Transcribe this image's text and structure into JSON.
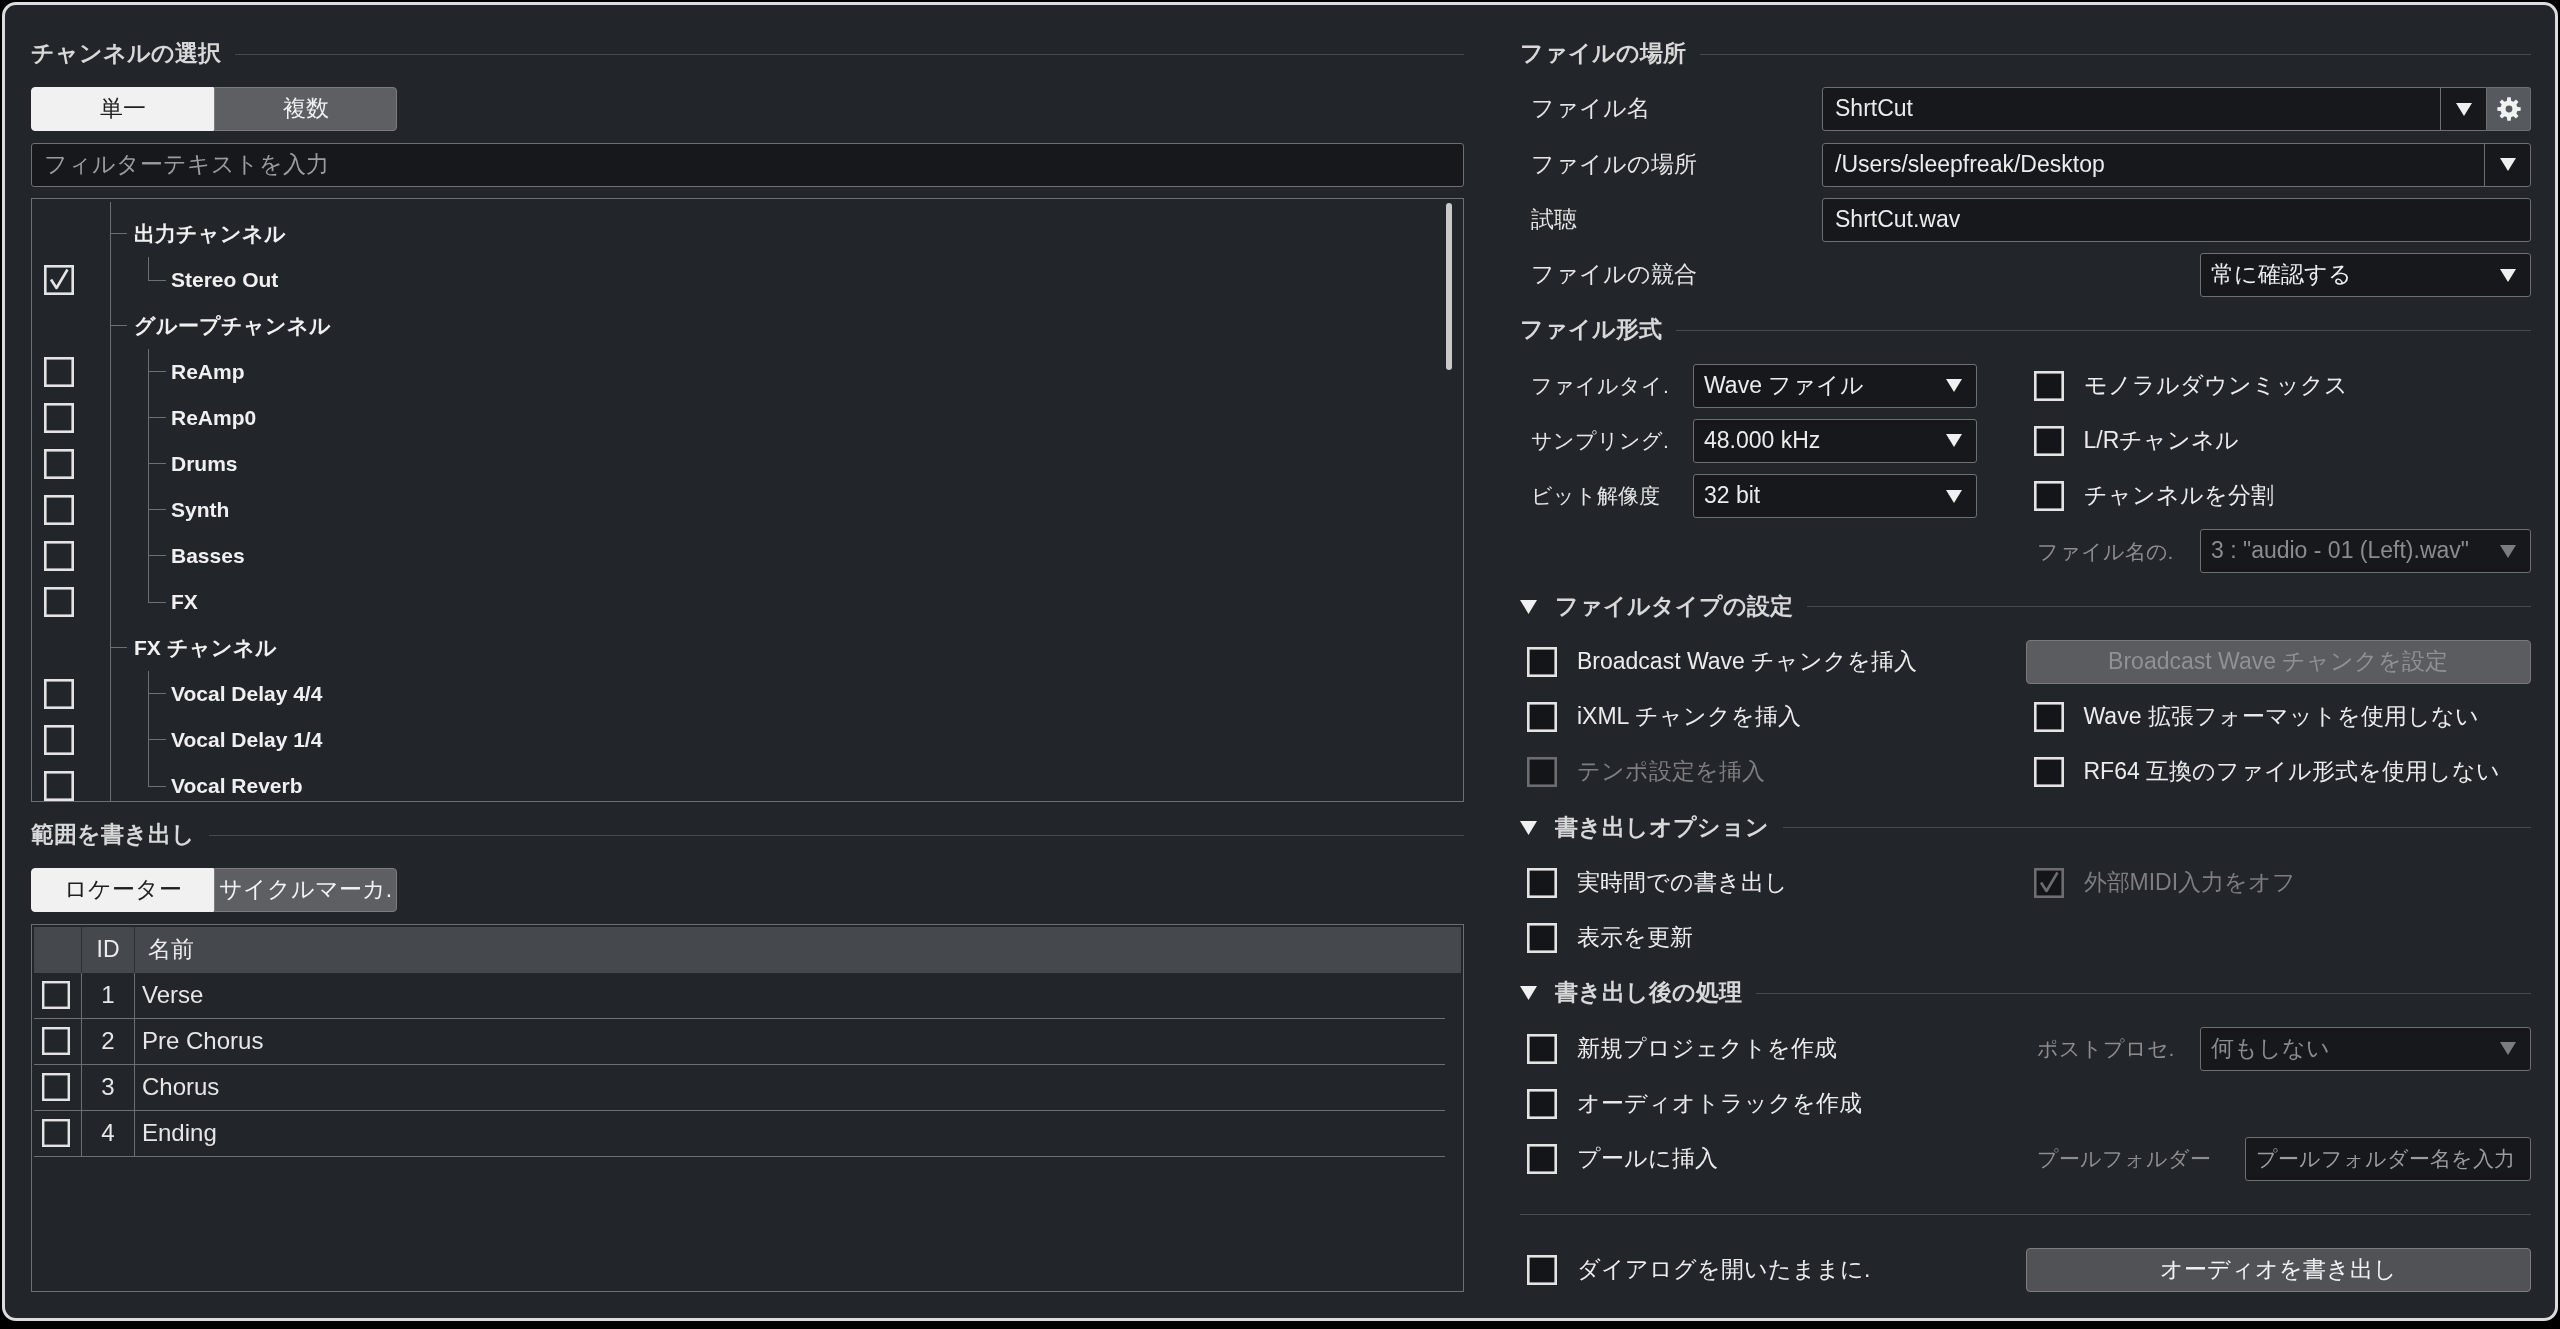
{
  "channel_selection": {
    "title": "チャンネルの選択",
    "modes": [
      {
        "label": "単一",
        "selected": true
      },
      {
        "label": "複数",
        "selected": false
      }
    ],
    "filter": {
      "placeholder": "フィルターテキストを入力"
    },
    "tree": [
      {
        "label": "出力チャンネル",
        "children": [
          {
            "label": "Stereo Out",
            "checked": true
          }
        ]
      },
      {
        "label": "グループチャンネル",
        "children": [
          {
            "label": "ReAmp",
            "checked": false
          },
          {
            "label": "ReAmp0",
            "checked": false
          },
          {
            "label": "Drums",
            "checked": false
          },
          {
            "label": "Synth",
            "checked": false
          },
          {
            "label": "Basses",
            "checked": false
          },
          {
            "label": "FX",
            "checked": false
          }
        ]
      },
      {
        "label": "FX チャンネル",
        "children": [
          {
            "label": "Vocal Delay 4/4",
            "checked": false
          },
          {
            "label": "Vocal Delay 1/4",
            "checked": false
          },
          {
            "label": "Vocal Reverb",
            "checked": false
          }
        ]
      }
    ]
  },
  "export_range": {
    "title": "範囲を書き出し",
    "modes": [
      {
        "label": "ロケーター",
        "selected": true
      },
      {
        "label": "サイクルマーカ.",
        "selected": false
      }
    ],
    "table": {
      "columns": [
        "ID",
        "名前"
      ],
      "rows": [
        {
          "checked": false,
          "id": "1",
          "name": "Verse"
        },
        {
          "checked": false,
          "id": "2",
          "name": "Pre Chorus"
        },
        {
          "checked": false,
          "id": "3",
          "name": "Chorus"
        },
        {
          "checked": false,
          "id": "4",
          "name": "Ending"
        }
      ]
    }
  },
  "file_location": {
    "title": "ファイルの場所",
    "rows": [
      {
        "kind": "combo",
        "label": "ファイル名",
        "value": "ShrtCut",
        "settings": true
      },
      {
        "kind": "combo",
        "label": "ファイルの場所",
        "value": "/Users/sleepfreak/Desktop"
      },
      {
        "kind": "text",
        "label": "試聴",
        "value": "ShrtCut.wav"
      },
      {
        "kind": "select",
        "label": "ファイルの競合",
        "value": "常に確認する"
      }
    ]
  },
  "file_format": {
    "title": "ファイル形式",
    "rows": [
      {
        "left": {
          "kind": "select",
          "label": "ファイルタイ.",
          "value": "Wave ファイル",
          "disabled": false
        },
        "right": {
          "kind": "checkbox",
          "label": "モノラルダウンミックス",
          "checked": false,
          "disabled": false
        }
      },
      {
        "left": {
          "kind": "select",
          "label": "サンプリング.",
          "value": "48.000 kHz",
          "disabled": false
        },
        "right": {
          "kind": "checkbox",
          "label": "L/Rチャンネル",
          "checked": false,
          "disabled": false
        }
      },
      {
        "left": {
          "kind": "select",
          "label": "ビット解像度",
          "value": "32 bit",
          "disabled": false
        },
        "right": {
          "kind": "checkbox",
          "label": "チャンネルを分割",
          "checked": false,
          "disabled": false
        }
      },
      {
        "right": {
          "kind": "select",
          "label": "ファイル名の.",
          "value": "3 : \"audio - 01 (Left).wav\"",
          "disabled": true
        }
      }
    ]
  },
  "file_type_settings": {
    "title": "ファイルタイプの設定",
    "expanded": true,
    "rows": [
      {
        "left": {
          "kind": "checkbox",
          "label": "Broadcast Wave チャンクを挿入",
          "checked": false,
          "disabled": false
        },
        "right": {
          "kind": "button",
          "label": "Broadcast Wave チャンクを設定",
          "disabled": true
        }
      },
      {
        "left": {
          "kind": "checkbox",
          "label": "iXML チャンクを挿入",
          "checked": false,
          "disabled": false
        },
        "right": {
          "kind": "checkbox",
          "label": "Wave 拡張フォーマットを使用しない",
          "checked": false,
          "disabled": false
        }
      },
      {
        "left": {
          "kind": "checkbox",
          "label": "テンポ設定を挿入",
          "checked": false,
          "disabled": true
        },
        "right": {
          "kind": "checkbox",
          "label": "RF64 互換のファイル形式を使用しない",
          "checked": false,
          "disabled": false
        }
      }
    ]
  },
  "export_options": {
    "title": "書き出しオプション",
    "expanded": true,
    "rows": [
      {
        "left": {
          "kind": "checkbox",
          "label": "実時間での書き出し",
          "checked": false,
          "disabled": false
        },
        "right": {
          "kind": "checkbox",
          "label": "外部MIDI入力をオフ",
          "checked": true,
          "disabled": true
        }
      },
      {
        "left": {
          "kind": "checkbox",
          "label": "表示を更新",
          "checked": false,
          "disabled": false
        }
      }
    ]
  },
  "post_processing": {
    "title": "書き出し後の処理",
    "expanded": true,
    "rows": [
      {
        "left": {
          "kind": "checkbox",
          "label": "新規プロジェクトを作成",
          "checked": false,
          "disabled": false
        },
        "right": {
          "kind": "select",
          "label": "ポストプロセ.",
          "value": "何もしない",
          "disabled": true
        }
      },
      {
        "left": {
          "kind": "checkbox",
          "label": "オーディオトラックを作成",
          "checked": false,
          "disabled": false
        }
      },
      {
        "left": {
          "kind": "checkbox",
          "label": "プールに挿入",
          "checked": false,
          "disabled": false
        },
        "right": {
          "kind": "input",
          "label": "プールフォルダー",
          "placeholder": "プールフォルダー名を入力",
          "disabled": true
        }
      }
    ]
  },
  "footer": {
    "left": {
      "kind": "checkbox",
      "label": "ダイアログを開いたままに.",
      "checked": false,
      "disabled": false
    },
    "right": {
      "kind": "button",
      "label": "オーディオを書き出し",
      "disabled": false
    }
  }
}
